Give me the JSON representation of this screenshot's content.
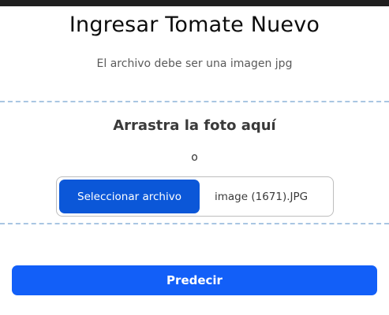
{
  "page": {
    "title": "Ingresar Tomate Nuevo",
    "subtitle": "El archivo debe ser una imagen jpg"
  },
  "dropzone": {
    "title": "Arrastra la foto aquí",
    "or_text": "o"
  },
  "file_picker": {
    "button_label": "Seleccionar archivo",
    "selected_file": "image (1671).JPG"
  },
  "actions": {
    "predict_label": "Predecir"
  },
  "colors": {
    "primary_button": "#125ff8",
    "file_button": "#0b57d8",
    "dashed_border": "#a9c6e2"
  }
}
